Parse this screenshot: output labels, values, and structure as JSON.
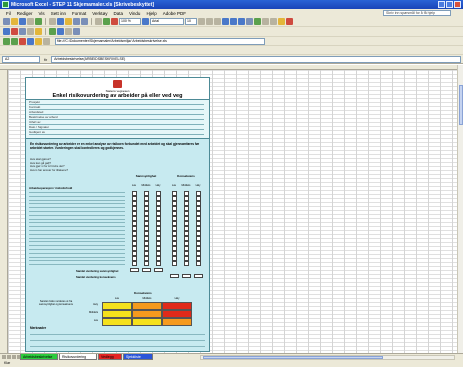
{
  "window": {
    "title": "Microsoft Excel - STEP 11 Skjemamaler.xls [Skrivebeskyttet]"
  },
  "menu": [
    "Fil",
    "Rediger",
    "Vis",
    "Sett inn",
    "Format",
    "Verktøy",
    "Data",
    "Vindu",
    "Hjelp",
    "Adobe PDF"
  ],
  "help_placeholder": "Skriv inn spørsmål for å få hjelp",
  "toolbar": {
    "font_name": "Arial",
    "font_size": "10",
    "zoom": "100 %",
    "web_address": "file:///C:/Dokumenter/Skjemamaler/Arbeidsmiljø/ Arbeidsbeskrivelse.xls"
  },
  "formula": {
    "name_box": "A2",
    "fx": "fx",
    "content": "Arbeidsbeskrivelse(ARBEIDSBESKRIVELSE)"
  },
  "form": {
    "org": "Statens vegvesen",
    "title": "Enkel risikovurdering av arbeider på eller ved veg",
    "info_lines": [
      "Prosjekt",
      "Kontrakt",
      "Arbeidsted",
      "Beskrivelse av arbeid",
      "Utført av",
      "Dato / Signatur",
      "Godkjent av"
    ],
    "description": "En risikovurdering av arbeider er en enkel analyse av risikoen forbundet med arbeidet og skal gjennomføres før arbeidet starter. Vurderingen skal kontrolleres og godkjennes.",
    "questions": [
      "Hva skal gjøres?",
      "Hva kan gå galt?",
      "Hva gjør vi for å hindre det?",
      "Hvem har ansvar for tiltakene?"
    ],
    "group_headers": [
      "Sannsynlighet",
      "Konsekvens"
    ],
    "sub_headers": [
      "Lav",
      "Middels",
      "Høy",
      "Lav",
      "Middels",
      "Høy"
    ],
    "table_header": "Arbeidsoperasjon / risikoforhold",
    "sum_rows": [
      "Samlet vurdering sannsynlighet",
      "Samlet vurdering konsekvens"
    ],
    "matrix": {
      "title": "Konsekvens",
      "label": "Samlet risiko vurderes ut fra sannsynlighet og konsekvens",
      "cols": [
        "Lav",
        "Middels",
        "Høy"
      ],
      "rows": [
        "Høy",
        "Middels",
        "Lav"
      ]
    },
    "notes_label": "Merknader"
  },
  "tabs": [
    "Arbeidsbeskrivelse",
    "Risikovurdering",
    "Vedlegg",
    "Sjekkliste"
  ],
  "status": "Klar",
  "colors": {
    "form_bg": "#c7eaf0",
    "matrix_yellow": "#f5e11c",
    "matrix_orange": "#f59a1e",
    "matrix_red": "#e02a1a",
    "tab_green": "#2ccb3c",
    "tab_red": "#e42525",
    "tab_blue": "#2b55d8"
  }
}
